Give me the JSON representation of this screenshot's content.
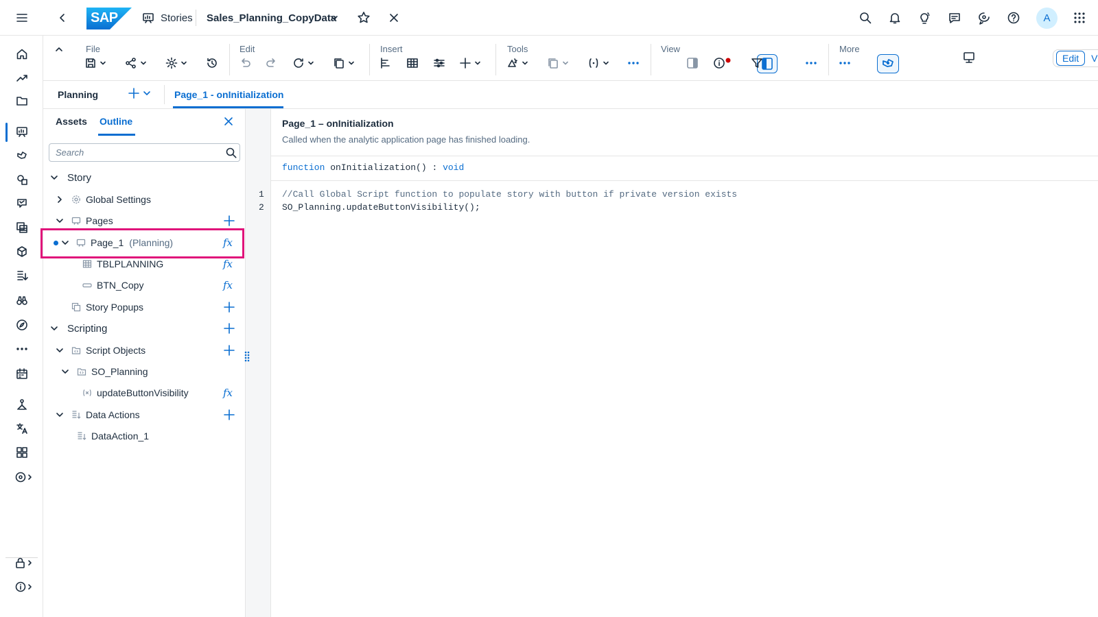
{
  "shell": {
    "logo_text": "SAP",
    "breadcrumb_label": "Stories",
    "story_title": "Sales_Planning_CopyData",
    "avatar_initial": "A"
  },
  "toolbar": {
    "groups": {
      "file": "File",
      "edit": "Edit",
      "insert": "Insert",
      "tools": "Tools",
      "view": "View",
      "more": "More"
    },
    "mode_edit": "Edit",
    "mode_view": "View"
  },
  "tabs": {
    "page_label": "Planning",
    "script_tab": "Page_1 - onInitialization"
  },
  "outline_panel": {
    "tab_assets": "Assets",
    "tab_outline": "Outline",
    "search_placeholder": "Search",
    "tree": {
      "story": "Story",
      "global_settings": "Global Settings",
      "pages": "Pages",
      "page_1": "Page_1",
      "page_1_type": "(Planning)",
      "tblplanning": "TBLPLANNING",
      "btn_copy": "BTN_Copy",
      "story_popups": "Story Popups",
      "scripting": "Scripting",
      "script_objects": "Script Objects",
      "so_planning": "SO_Planning",
      "update_fn": "updateButtonVisibility",
      "data_actions": "Data Actions",
      "data_action_1": "DataAction_1"
    },
    "fx_glyph": "fx"
  },
  "editor": {
    "title": "Page_1 – onInitialization",
    "description": "Called when the analytic application page has finished loading.",
    "signature_keyword": "function",
    "signature_name": "onInitialization() :",
    "signature_return": "void",
    "lines": [
      {
        "number": "1",
        "code": "//Call Global Script function to populate story with button if private version exists"
      },
      {
        "number": "2",
        "code": "SO_Planning.updateButtonVisibility();"
      }
    ]
  },
  "colors": {
    "accent": "#0a6ed1",
    "highlight": "#e0137a",
    "text": "#1d2d3e"
  }
}
